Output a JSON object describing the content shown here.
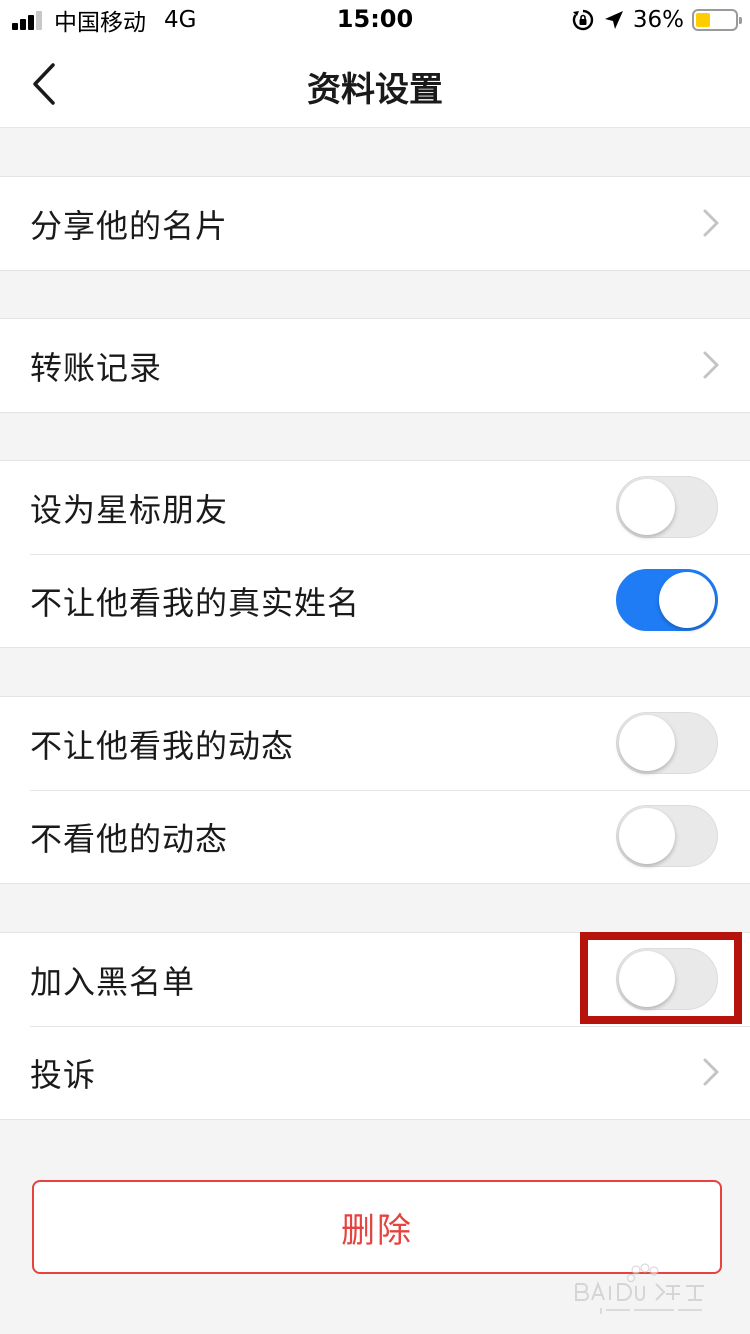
{
  "status_bar": {
    "carrier": "中国移动",
    "network": "4G",
    "time": "15:00",
    "battery_percent": "36%",
    "battery_level": 0.36
  },
  "nav": {
    "title": "资料设置"
  },
  "sections": {
    "share": {
      "label": "分享他的名片"
    },
    "transfer": {
      "label": "转账记录"
    },
    "star": {
      "label": "设为星标朋友",
      "on": false
    },
    "hide_name": {
      "label": "不让他看我的真实姓名",
      "on": true
    },
    "hide_moments": {
      "label": "不让他看我的动态",
      "on": false
    },
    "not_see": {
      "label": "不看他的动态",
      "on": false
    },
    "blacklist": {
      "label": "加入黑名单",
      "on": false
    },
    "complain": {
      "label": "投诉"
    }
  },
  "actions": {
    "delete_label": "删除"
  },
  "colors": {
    "toggle_on": "#1f7cf5",
    "delete_red": "#e64340",
    "highlight": "#b5130c",
    "battery": "#ffcc00"
  }
}
